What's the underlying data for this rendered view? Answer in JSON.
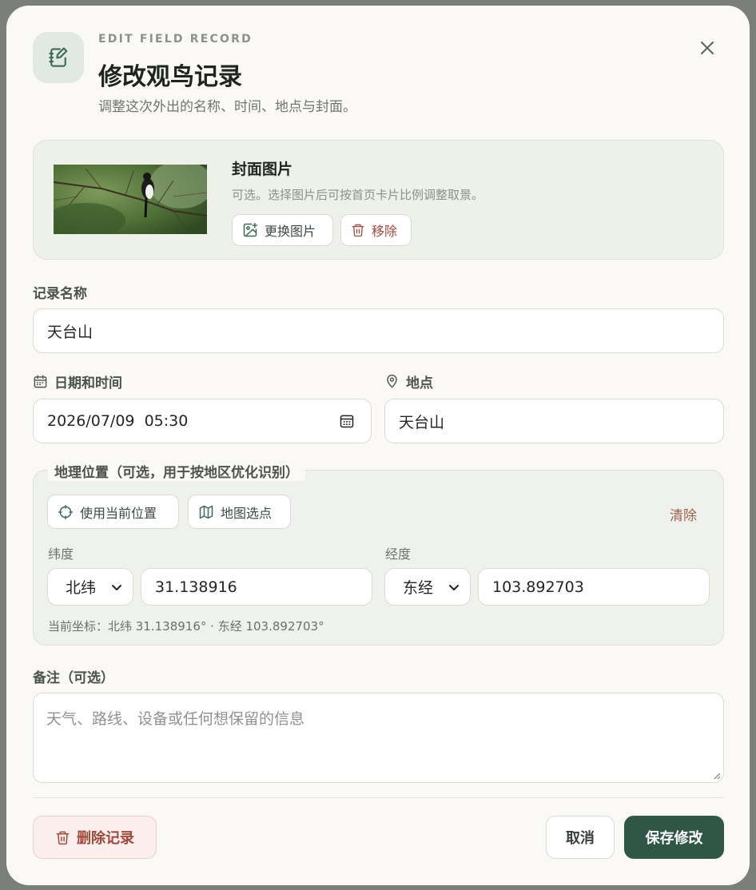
{
  "header": {
    "eyebrow": "EDIT FIELD RECORD",
    "title": "修改观鸟记录",
    "subtitle": "调整这次外出的名称、时间、地点与封面。"
  },
  "cover": {
    "title": "封面图片",
    "description": "可选。选择图片后可按首页卡片比例调整取景。",
    "replace_label": "更换图片",
    "remove_label": "移除"
  },
  "name_field": {
    "label": "记录名称",
    "value": "天台山"
  },
  "datetime_field": {
    "label": "日期和时间",
    "value": "2026/07/09  05:30"
  },
  "location_field": {
    "label": "地点",
    "value": "天台山"
  },
  "geo": {
    "legend": "地理位置（可选，用于按地区优化识别）",
    "use_current_label": "使用当前位置",
    "map_pick_label": "地图选点",
    "clear_label": "清除",
    "lat_label": "纬度",
    "lat_hemisphere": "北纬",
    "lat_value": "31.138916",
    "lon_label": "经度",
    "lon_hemisphere": "东经",
    "lon_value": "103.892703",
    "current_coords": "当前坐标：北纬 31.138916° · 东经 103.892703°"
  },
  "notes_field": {
    "label": "备注（可选）",
    "placeholder": "天气、路线、设备或任何想保留的信息"
  },
  "footer": {
    "delete_label": "删除记录",
    "cancel_label": "取消",
    "save_label": "保存修改"
  },
  "colors": {
    "primary": "#2f5647",
    "danger": "#a14a3c",
    "accent_bg": "#e1e9e3"
  }
}
